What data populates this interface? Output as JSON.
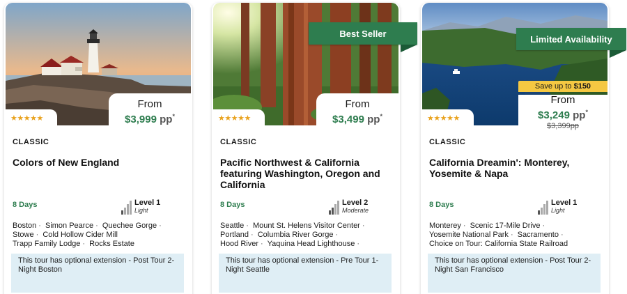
{
  "tours": [
    {
      "badge": "",
      "rating_stars": "★★★★★",
      "price_from_label": "From",
      "price_amount": "$3,999",
      "price_unit": "pp",
      "price_note": "*",
      "category": "CLASSIC",
      "title": "Colors of New England",
      "duration": "8 Days",
      "level_name": "Level 1",
      "level_desc": "Light",
      "level_value": 1,
      "stops": [
        "Boston",
        "Simon Pearce",
        "Quechee Gorge",
        "Stowe",
        "Cold Hollow Cider Mill",
        "Trapp Family Lodge",
        "Rocks Estate"
      ],
      "extension": "This tour has optional extension - Post Tour 2-Night Boston"
    },
    {
      "badge": "Best Seller",
      "rating_stars": "★★★★★",
      "price_from_label": "From",
      "price_amount": "$3,499",
      "price_unit": "pp",
      "price_note": "*",
      "category": "CLASSIC",
      "title": "Pacific Northwest & California featuring Washington, Oregon and California",
      "duration": "8 Days",
      "level_name": "Level 2",
      "level_desc": "Moderate",
      "level_value": 2,
      "stops": [
        "Seattle",
        "Mount St. Helens Visitor Center",
        "Portland",
        "Columbia River Gorge",
        "Hood River",
        "Yaquina Head Lighthouse"
      ],
      "extension": "This tour has optional extension - Pre Tour 1-Night Seattle"
    },
    {
      "badge": "Limited Availability",
      "rating_stars": "★★★★★",
      "save_prefix": "Save up to",
      "save_amount": "$150",
      "price_from_label": "From",
      "price_amount": "$3,249",
      "price_unit": "pp",
      "price_note": "*",
      "old_price": "$3,399pp",
      "category": "CLASSIC",
      "title": "California Dreamin': Monterey, Yosemite & Napa",
      "duration": "8 Days",
      "level_name": "Level 1",
      "level_desc": "Light",
      "level_value": 1,
      "stops": [
        "Monterey",
        "Scenic 17-Mile Drive",
        "Yosemite National Park",
        "Sacramento",
        "Choice on Tour: California State Railroad"
      ],
      "extension": "This tour has optional extension - Post Tour 2-Night San Francisco"
    }
  ],
  "colors": {
    "brand_green": "#2e7d4f",
    "star_gold": "#e9a21d",
    "save_yellow": "#f5c842",
    "extension_bg": "#dfeef5"
  },
  "icons": {
    "rating": "star-icon",
    "level": "activity-level-bars-icon"
  }
}
